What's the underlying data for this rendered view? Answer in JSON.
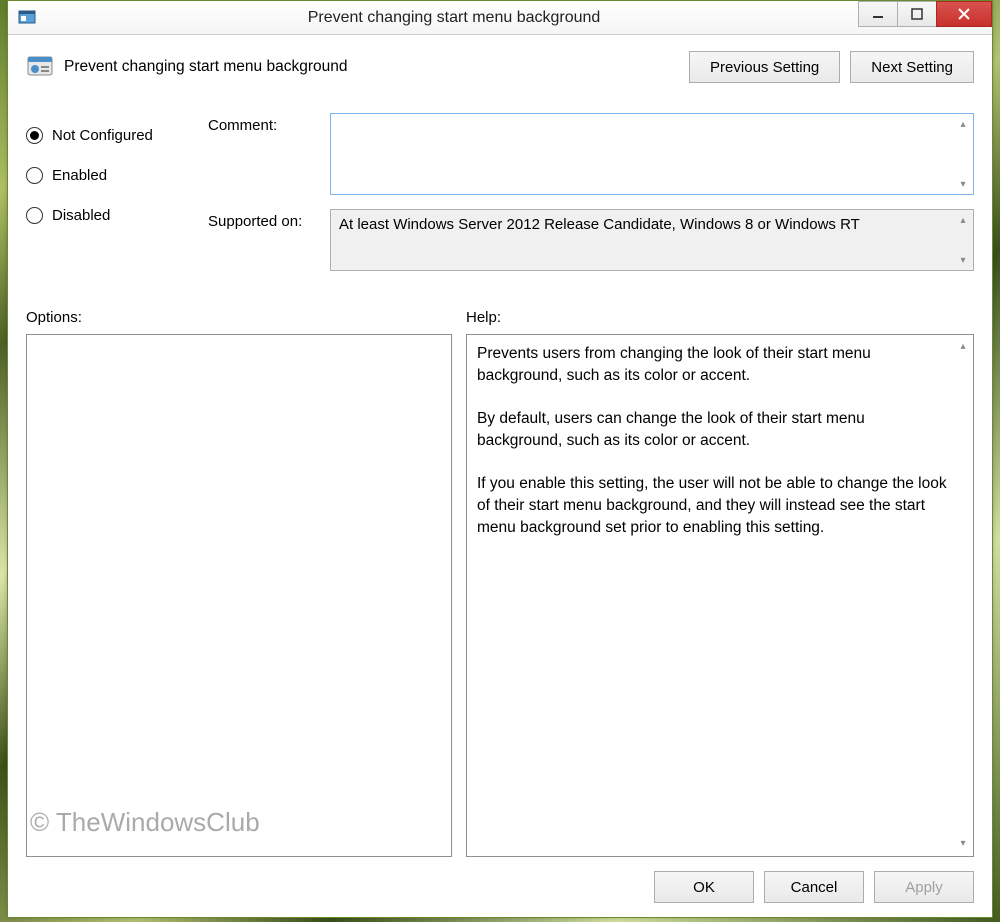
{
  "window": {
    "title": "Prevent changing start menu background"
  },
  "header": {
    "policy_title": "Prevent changing start menu background",
    "prev_label": "Previous Setting",
    "next_label": "Next Setting"
  },
  "radios": {
    "not_configured": "Not Configured",
    "enabled": "Enabled",
    "disabled": "Disabled",
    "selected": "not_configured"
  },
  "fields": {
    "comment_label": "Comment:",
    "comment_value": "",
    "supported_label": "Supported on:",
    "supported_value": "At least Windows Server 2012 Release Candidate, Windows 8 or Windows RT"
  },
  "panes": {
    "options_label": "Options:",
    "help_label": "Help:",
    "help_text": "Prevents users from changing the look of their start menu background, such as its color or accent.\n\nBy default, users can change the look of their start menu background, such as its color or accent.\n\nIf you enable this setting, the user will not be able to change the look of their start menu background, and they will instead see the start menu background set prior to enabling this setting."
  },
  "footer": {
    "ok": "OK",
    "cancel": "Cancel",
    "apply": "Apply"
  },
  "watermark": "© TheWindowsClub"
}
